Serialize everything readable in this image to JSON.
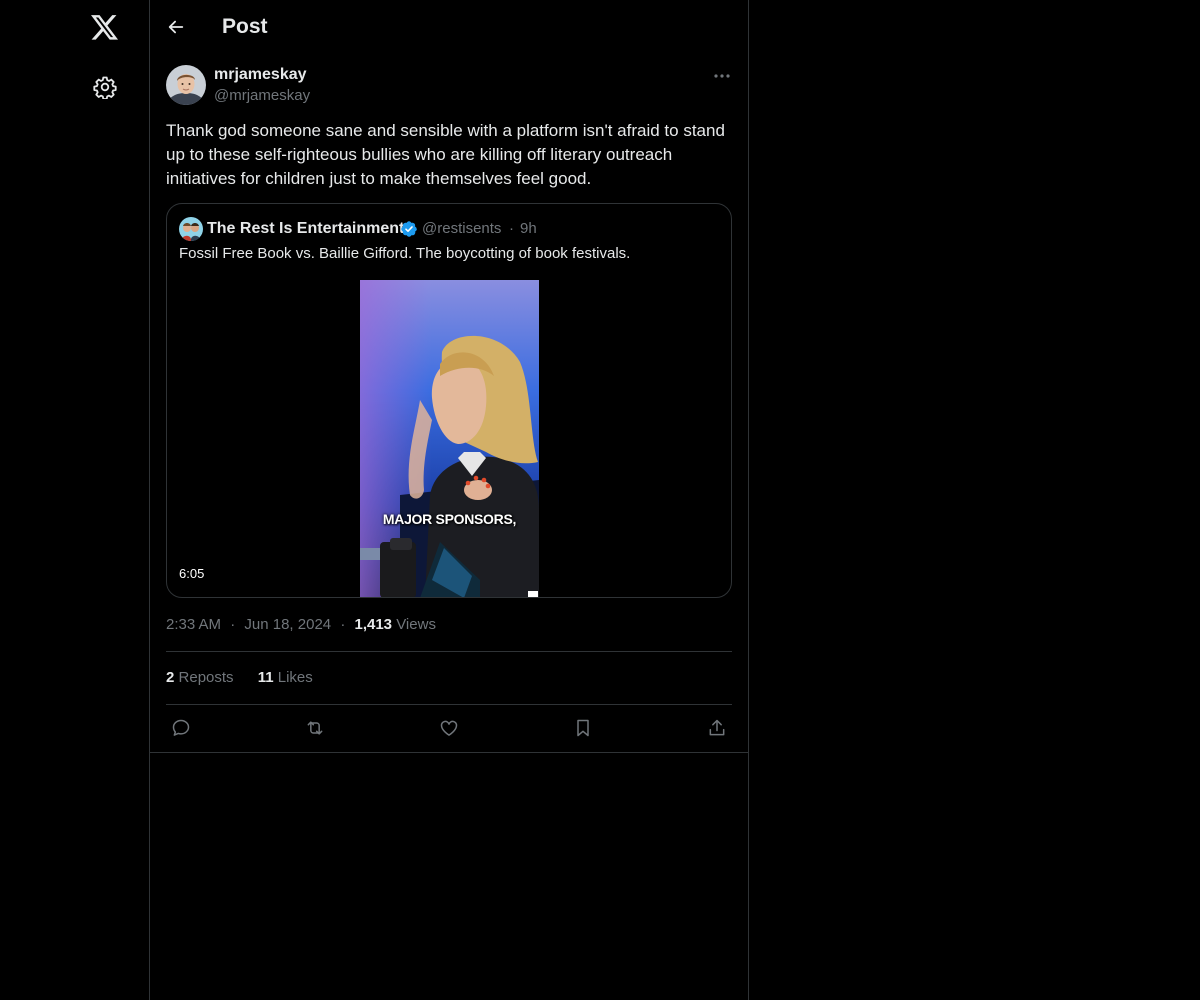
{
  "header": {
    "title": "Post"
  },
  "tweet": {
    "author_name": "mrjameskay",
    "author_handle": "@mrjameskay",
    "text": "Thank god someone sane and sensible with a platform isn't afraid to stand up to these self-righteous bullies who are killing off literary outreach initiatives for children just to make themselves feel good.",
    "time": "2:33 AM",
    "date": "Jun 18, 2024",
    "views_count": "1,413",
    "views_label": "Views",
    "reposts_count": "2",
    "reposts_label": "Reposts",
    "likes_count": "11",
    "likes_label": "Likes"
  },
  "quote": {
    "name": "The Rest Is Entertainment",
    "handle": "@restisents",
    "time": "9h",
    "text": "Fossil Free Book vs. Baillie Gifford. The boycotting of book festivals.",
    "video_caption": "MAJOR SPONSORS,",
    "duration": "6:05"
  },
  "separators": {
    "dot": "·"
  },
  "icons": {
    "logo": "x-logo-icon",
    "settings": "gear-icon",
    "back": "arrow-left-icon",
    "more": "more-horizontal-icon",
    "verified": "verified-badge-icon",
    "reply": "reply-icon",
    "repost": "repost-icon",
    "like": "heart-icon",
    "bookmark": "bookmark-icon",
    "share": "share-icon"
  },
  "colors": {
    "background": "#000000",
    "text_primary": "#e7e9ea",
    "text_secondary": "#71767b",
    "border": "#2f3336",
    "verified": "#1d9bf0"
  }
}
